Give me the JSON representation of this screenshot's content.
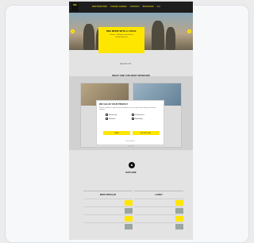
{
  "nav": {
    "logo": "NG",
    "links": [
      "DESTINATIONS",
      "TRAVEL GUIDES",
      "CONTACT",
      "BOOKINGS",
      "A-Z"
    ]
  },
  "hero": {
    "title": "SEE MORE WITH A LOCAL",
    "subtitle": "Greece · Meteora monasteries",
    "subtitle2": "Guided day tour",
    "date": "",
    "link": "SEE PHOTOS"
  },
  "section": {
    "title": "WHAT ARE THE BEST MUSEUMS"
  },
  "tiles": [
    {
      "text": ""
    },
    {
      "text": ""
    }
  ],
  "modal": {
    "title": "WE VALUE YOUR PRIVACY",
    "text": "We use cookies to improve your experience on our site and to show you relevant content.",
    "options": [
      "Necessary",
      "Preferences",
      "Statistics",
      "Marketing"
    ],
    "save_label": "SAVE",
    "accept_label": "ACCEPT ALL",
    "more_label": "Show details"
  },
  "lower": {
    "title": "EXPLORE",
    "subtitle": ""
  },
  "columns": [
    {
      "heading": "MOST POPULAR",
      "rows": [
        "",
        "",
        "",
        ""
      ]
    },
    {
      "heading": "LATEST",
      "rows": [
        "",
        "",
        "",
        ""
      ]
    }
  ],
  "colors": {
    "accent": "#ffe600",
    "nav": "#1d1d1d",
    "page": "#e3e3e3"
  }
}
